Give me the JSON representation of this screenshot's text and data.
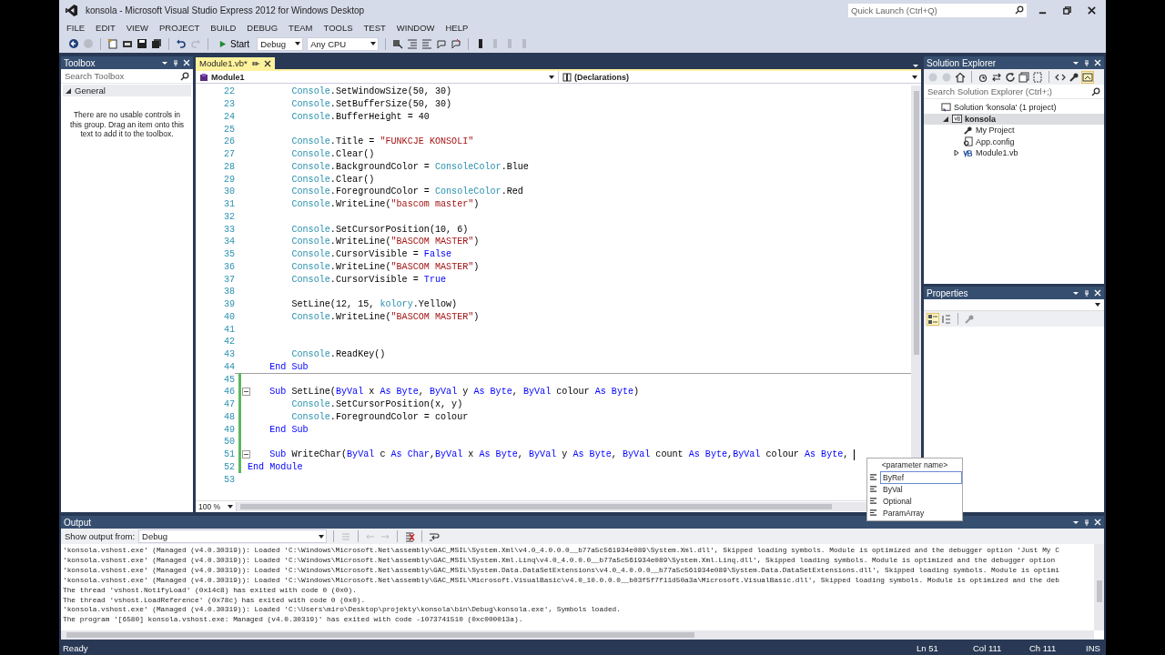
{
  "window": {
    "title": "konsola - Microsoft Visual Studio Express 2012 for Windows Desktop"
  },
  "quick_launch": {
    "placeholder": "Quick Launch (Ctrl+Q)"
  },
  "menu": [
    "FILE",
    "EDIT",
    "VIEW",
    "PROJECT",
    "BUILD",
    "DEBUG",
    "TEAM",
    "TOOLS",
    "TEST",
    "WINDOW",
    "HELP"
  ],
  "toolbar": {
    "start": "Start",
    "configuration": "Debug",
    "platform": "Any CPU"
  },
  "toolbox": {
    "title": "Toolbox",
    "search": {
      "placeholder": "Search Toolbox"
    },
    "group": {
      "label": "General",
      "expanded": true
    },
    "empty_text": "There are no usable controls in this group. Drag an item onto this text to add it to the toolbox."
  },
  "editor": {
    "tabs": [
      {
        "label": "Module1.vb*",
        "selected": true
      }
    ],
    "type_dropdown": "Module1",
    "member_dropdown": "(Declarations)",
    "zoom": "100 %",
    "lines": [
      {
        "num": "22",
        "kind": "statement",
        "tokens": [
          {
            "kind": "type",
            "text": "Console"
          },
          {
            "kind": "plain",
            "text": ".SetWindowSize(50, 30)"
          }
        ]
      },
      {
        "num": "23",
        "kind": "statement",
        "tokens": [
          {
            "kind": "type",
            "text": "Console"
          },
          {
            "kind": "plain",
            "text": ".SetBufferSize(50, 30)"
          }
        ]
      },
      {
        "num": "24",
        "kind": "statement",
        "tokens": [
          {
            "kind": "type",
            "text": "Console"
          },
          {
            "kind": "plain",
            "text": ".BufferHeight = 40"
          }
        ]
      },
      {
        "num": "25"
      },
      {
        "num": "26",
        "kind": "statement",
        "tokens": [
          {
            "kind": "type",
            "text": "Console"
          },
          {
            "kind": "plain",
            "text": ".Title = "
          },
          {
            "kind": "string",
            "text": "\"FUNKCJE KONSOLI\""
          }
        ]
      },
      {
        "num": "27",
        "kind": "statement",
        "tokens": [
          {
            "kind": "type",
            "text": "Console"
          },
          {
            "kind": "plain",
            "text": ".Clear()"
          }
        ]
      },
      {
        "num": "28",
        "kind": "statement",
        "tokens": [
          {
            "kind": "type",
            "text": "Console"
          },
          {
            "kind": "plain",
            "text": ".BackgroundColor = "
          },
          {
            "kind": "type",
            "text": "ConsoleColor"
          },
          {
            "kind": "plain",
            "text": ".Blue"
          }
        ]
      },
      {
        "num": "29",
        "kind": "statement",
        "tokens": [
          {
            "kind": "type",
            "text": "Console"
          },
          {
            "kind": "plain",
            "text": ".Clear()"
          }
        ]
      },
      {
        "num": "30",
        "kind": "statement",
        "tokens": [
          {
            "kind": "type",
            "text": "Console"
          },
          {
            "kind": "plain",
            "text": ".ForegroundColor = "
          },
          {
            "kind": "type",
            "text": "ConsoleColor"
          },
          {
            "kind": "plain",
            "text": ".Red"
          }
        ]
      },
      {
        "num": "31",
        "kind": "statement",
        "tokens": [
          {
            "kind": "type",
            "text": "Console"
          },
          {
            "kind": "plain",
            "text": ".WriteLine("
          },
          {
            "kind": "string",
            "text": "\"bascom master\""
          },
          {
            "kind": "plain",
            "text": ")"
          }
        ]
      },
      {
        "num": "32"
      },
      {
        "num": "33",
        "kind": "statement",
        "tokens": [
          {
            "kind": "type",
            "text": "Console"
          },
          {
            "kind": "plain",
            "text": ".SetCursorPosition(10, 6)"
          }
        ]
      },
      {
        "num": "34",
        "kind": "statement",
        "tokens": [
          {
            "kind": "type",
            "text": "Console"
          },
          {
            "kind": "plain",
            "text": ".WriteLine("
          },
          {
            "kind": "string",
            "text": "\"BASCOM MASTER\""
          },
          {
            "kind": "plain",
            "text": ")"
          }
        ]
      },
      {
        "num": "35",
        "kind": "statement",
        "tokens": [
          {
            "kind": "type",
            "text": "Console"
          },
          {
            "kind": "plain",
            "text": ".CursorVisible = "
          },
          {
            "kind": "keyword",
            "text": "False"
          }
        ]
      },
      {
        "num": "36",
        "kind": "statement",
        "tokens": [
          {
            "kind": "type",
            "text": "Console"
          },
          {
            "kind": "plain",
            "text": ".WriteLine("
          },
          {
            "kind": "string",
            "text": "\"BASCOM MASTER\""
          },
          {
            "kind": "plain",
            "text": ")"
          }
        ]
      },
      {
        "num": "37",
        "kind": "statement",
        "tokens": [
          {
            "kind": "type",
            "text": "Console"
          },
          {
            "kind": "plain",
            "text": ".CursorVisible = "
          },
          {
            "kind": "keyword",
            "text": "True"
          }
        ]
      },
      {
        "num": "38"
      },
      {
        "num": "39",
        "kind": "statement",
        "tokens": [
          {
            "kind": "plain",
            "text": "SetLine(12, 15, "
          },
          {
            "kind": "type",
            "text": "kolory"
          },
          {
            "kind": "plain",
            "text": ".Yellow)"
          }
        ]
      },
      {
        "num": "40",
        "kind": "statement",
        "tokens": [
          {
            "kind": "type",
            "text": "Console"
          },
          {
            "kind": "plain",
            "text": ".WriteLine("
          },
          {
            "kind": "string",
            "text": "\"BASCOM MASTER\""
          },
          {
            "kind": "plain",
            "text": ")"
          }
        ]
      },
      {
        "num": "41"
      },
      {
        "num": "42"
      },
      {
        "num": "43",
        "kind": "statement",
        "tokens": [
          {
            "kind": "type",
            "text": "Console"
          },
          {
            "kind": "plain",
            "text": ".ReadKey()"
          }
        ]
      },
      {
        "num": "44",
        "kind": "member",
        "tokens": [
          {
            "kind": "keyword",
            "text": "End Sub"
          }
        ]
      },
      {
        "num": "45",
        "separator": true,
        "changed": true
      },
      {
        "num": "46",
        "changed": true,
        "fold": true,
        "kind": "member",
        "tokens": [
          {
            "kind": "keyword",
            "text": "Sub"
          },
          {
            "kind": "plain",
            "text": " SetLine("
          },
          {
            "kind": "keyword",
            "text": "ByVal"
          },
          {
            "kind": "plain",
            "text": " x "
          },
          {
            "kind": "keyword",
            "text": "As Byte"
          },
          {
            "kind": "plain",
            "text": ", "
          },
          {
            "kind": "keyword",
            "text": "ByVal"
          },
          {
            "kind": "plain",
            "text": " y "
          },
          {
            "kind": "keyword",
            "text": "As Byte"
          },
          {
            "kind": "plain",
            "text": ", "
          },
          {
            "kind": "keyword",
            "text": "ByVal"
          },
          {
            "kind": "plain",
            "text": " colour "
          },
          {
            "kind": "keyword",
            "text": "As Byte"
          },
          {
            "kind": "plain",
            "text": ")"
          }
        ]
      },
      {
        "num": "47",
        "changed": true,
        "kind": "statement",
        "tokens": [
          {
            "kind": "type",
            "text": "Console"
          },
          {
            "kind": "plain",
            "text": ".SetCursorPosition(x, y)"
          }
        ]
      },
      {
        "num": "48",
        "changed": true,
        "kind": "statement",
        "tokens": [
          {
            "kind": "type",
            "text": "Console"
          },
          {
            "kind": "plain",
            "text": ".ForegroundColor = colour"
          }
        ]
      },
      {
        "num": "49",
        "changed": true,
        "kind": "member",
        "tokens": [
          {
            "kind": "keyword",
            "text": "End Sub"
          }
        ]
      },
      {
        "num": "50",
        "changed": true
      },
      {
        "num": "51",
        "changed": true,
        "fold": true,
        "caret": true,
        "kind": "member",
        "tokens": [
          {
            "kind": "keyword",
            "text": "Sub"
          },
          {
            "kind": "plain",
            "text": " WriteChar("
          },
          {
            "kind": "keyword",
            "text": "ByVal"
          },
          {
            "kind": "plain",
            "text": " c "
          },
          {
            "kind": "keyword",
            "text": "As Char"
          },
          {
            "kind": "plain",
            "text": ","
          },
          {
            "kind": "keyword",
            "text": "ByVal"
          },
          {
            "kind": "plain",
            "text": " x "
          },
          {
            "kind": "keyword",
            "text": "As Byte"
          },
          {
            "kind": "plain",
            "text": ", "
          },
          {
            "kind": "keyword",
            "text": "ByVal"
          },
          {
            "kind": "plain",
            "text": " y "
          },
          {
            "kind": "keyword",
            "text": "As Byte"
          },
          {
            "kind": "plain",
            "text": ", "
          },
          {
            "kind": "keyword",
            "text": "ByVal"
          },
          {
            "kind": "plain",
            "text": " count "
          },
          {
            "kind": "keyword",
            "text": "As Byte"
          },
          {
            "kind": "plain",
            "text": ","
          },
          {
            "kind": "keyword",
            "text": "ByVal"
          },
          {
            "kind": "plain",
            "text": " colour "
          },
          {
            "kind": "keyword",
            "text": "As Byte"
          },
          {
            "kind": "plain",
            "text": ","
          }
        ]
      },
      {
        "num": "52",
        "changed": true,
        "kind": "module",
        "tokens": [
          {
            "kind": "keyword",
            "text": "End Module"
          }
        ]
      },
      {
        "num": "53"
      }
    ]
  },
  "parameter_popup": {
    "header": "<parameter name>",
    "items": [
      {
        "label": "ByRef",
        "selected": true
      },
      {
        "label": "ByVal",
        "selected": false
      },
      {
        "label": "Optional",
        "selected": false
      },
      {
        "label": "ParamArray",
        "selected": false
      }
    ]
  },
  "solution_explorer": {
    "title": "Solution Explorer",
    "search": {
      "placeholder": "Search Solution Explorer (Ctrl+;)"
    },
    "tree": [
      {
        "label": "Solution 'konsola' (1 project)",
        "kind": "solution",
        "selected": false,
        "children": [
          {
            "label": "konsola",
            "kind": "project",
            "selected": true,
            "expanded": true,
            "children": [
              {
                "label": "My Project",
                "kind": "wrench",
                "selected": false
              },
              {
                "label": "App.config",
                "kind": "config",
                "selected": false
              },
              {
                "label": "Module1.vb",
                "kind": "vbfile",
                "selected": false,
                "expanded": false
              }
            ]
          }
        ]
      }
    ]
  },
  "properties": {
    "title": "Properties"
  },
  "output": {
    "title": "Output",
    "source_label": "Show output from:",
    "source": "Debug",
    "lines": [
      "'konsola.vshost.exe' (Managed (v4.0.30319)): Loaded 'C:\\Windows\\Microsoft.Net\\assembly\\GAC_MSIL\\System.Xml\\v4.0_4.0.0.0__b77a5c561934e089\\System.Xml.dll', Skipped loading symbols. Module is optimized and the debugger option 'Just My C",
      "'konsola.vshost.exe' (Managed (v4.0.30319)): Loaded 'C:\\Windows\\Microsoft.Net\\assembly\\GAC_MSIL\\System.Xml.Linq\\v4.0_4.0.0.0__b77a5c561934e089\\System.Xml.Linq.dll', Skipped loading symbols. Module is optimized and the debugger option",
      "'konsola.vshost.exe' (Managed (v4.0.30319)): Loaded 'C:\\Windows\\Microsoft.Net\\assembly\\GAC_MSIL\\System.Data.DataSetExtensions\\v4.0_4.0.0.0__b77a5c561934e089\\System.Data.DataSetExtensions.dll', Skipped loading symbols. Module is optimi",
      "'konsola.vshost.exe' (Managed (v4.0.30319)): Loaded 'C:\\Windows\\Microsoft.Net\\assembly\\GAC_MSIL\\Microsoft.VisualBasic\\v4.0_10.0.0.0__b03f5f7f11d50a3a\\Microsoft.VisualBasic.dll', Skipped loading symbols. Module is optimized and the deb",
      "The thread 'vshost.NotifyLoad' (0x14c8) has exited with code 0 (0x0).",
      "The thread 'vshost.LoadReference' (0x78c) has exited with code 0 (0x0).",
      "'konsola.vshost.exe' (Managed (v4.0.30319)): Loaded 'C:\\Users\\miro\\Desktop\\projekty\\konsola\\bin\\Debug\\konsola.exe', Symbols loaded.",
      "The program '[6580] konsola.vshost.exe: Managed (v4.0.30319)' has exited with code -1073741510 (0xc000013a)."
    ]
  },
  "status_bar": {
    "message": "Ready",
    "line": "Ln 51",
    "column": "Col 111",
    "char": "Ch 111",
    "mode": "INS"
  }
}
